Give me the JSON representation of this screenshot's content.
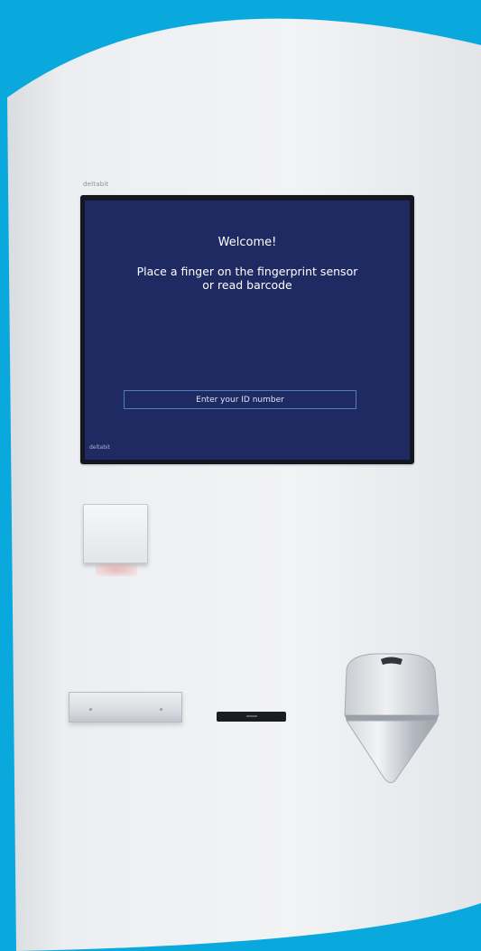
{
  "kiosk": {
    "brand_label": "deltabit",
    "colors": {
      "background": "#0aa9dd",
      "panel": "#eceef1",
      "screen": "#1f2a63",
      "input_border": "#4d7fb8"
    }
  },
  "screen": {
    "welcome": "Welcome!",
    "instruction_line1": "Place a finger on the fingerprint sensor",
    "instruction_line2": "or read barcode",
    "id_placeholder": "Enter your ID number",
    "brand_label": "deltabit"
  }
}
